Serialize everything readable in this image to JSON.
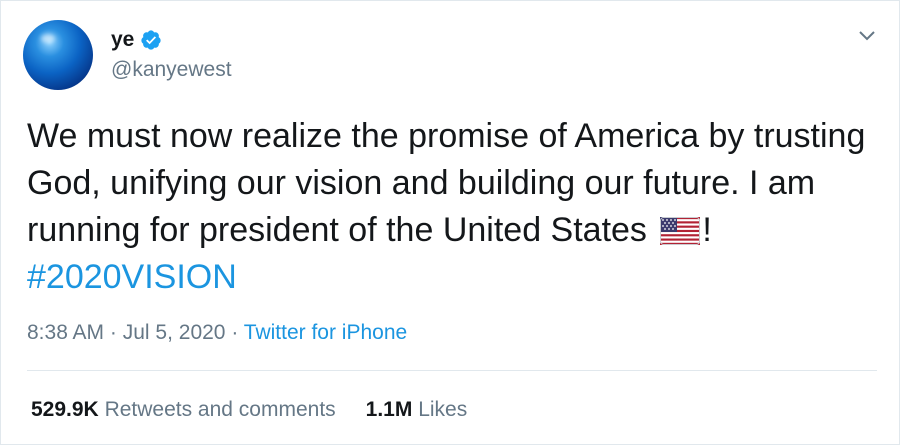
{
  "tweet": {
    "user": {
      "display_name": "ye",
      "handle": "@kanyewest",
      "verified": true,
      "avatar_icon": "blue-sphere-avatar"
    },
    "menu_icon": "chevron-down-icon",
    "text": {
      "line_part_1": "We must now realize the promise of America by trusting God, unifying our vision and building our future. I am running for president of the United States ",
      "emoji": "us-flag-emoji",
      "line_part_2": "! ",
      "hashtag": "#2020VISION"
    },
    "meta": {
      "time": "8:38 AM",
      "separator_1": " · ",
      "date": "Jul 5, 2020",
      "separator_2": " · ",
      "source": "Twitter for iPhone"
    },
    "stats": {
      "retweets_count": "529.9K",
      "retweets_label": "Retweets and comments",
      "likes_count": "1.1M",
      "likes_label": "Likes"
    },
    "colors": {
      "link": "#1b95e0",
      "text": "#14171a",
      "muted": "#657786",
      "border": "#e1e8ed"
    }
  }
}
